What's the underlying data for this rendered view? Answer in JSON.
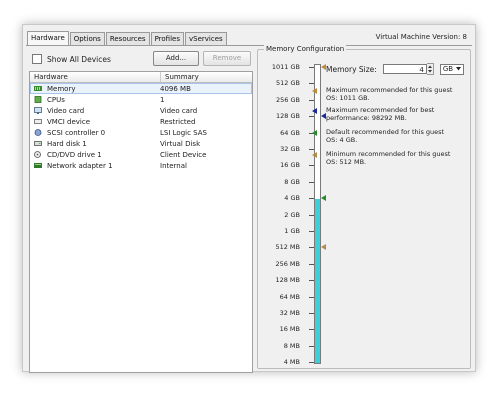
{
  "tabs": [
    {
      "label": "Hardware",
      "active": true
    },
    {
      "label": "Options",
      "active": false
    },
    {
      "label": "Resources",
      "active": false
    },
    {
      "label": "Profiles",
      "active": false
    },
    {
      "label": "vServices",
      "active": false
    }
  ],
  "vm_version": "Virtual Machine Version: 8",
  "show_all_label": "Show All Devices",
  "buttons": {
    "add": "Add...",
    "remove": "Remove"
  },
  "table": {
    "headers": [
      "Hardware",
      "Summary"
    ],
    "rows": [
      {
        "icon": "memory-icon",
        "name": "Memory",
        "summary": "4096 MB",
        "selected": true
      },
      {
        "icon": "cpu-icon",
        "name": "CPUs",
        "summary": "1",
        "selected": false
      },
      {
        "icon": "video-card-icon",
        "name": "Video card",
        "summary": "Video card",
        "selected": false
      },
      {
        "icon": "vmci-icon",
        "name": "VMCI device",
        "summary": "Restricted",
        "selected": false
      },
      {
        "icon": "scsi-icon",
        "name": "SCSI controller 0",
        "summary": "LSI Logic SAS",
        "selected": false
      },
      {
        "icon": "hard-disk-icon",
        "name": "Hard disk 1",
        "summary": "Virtual Disk",
        "selected": false
      },
      {
        "icon": "cd-dvd-icon",
        "name": "CD/DVD drive 1",
        "summary": "Client Device",
        "selected": false
      },
      {
        "icon": "network-adapter-icon",
        "name": "Network adapter 1",
        "summary": "Internal",
        "selected": false
      }
    ]
  },
  "memory_config": {
    "title": "Memory Configuration",
    "scale": [
      "1011 GB",
      "512 GB",
      "256 GB",
      "128 GB",
      "64 GB",
      "32 GB",
      "16 GB",
      "8 GB",
      "4 GB",
      "2 GB",
      "1 GB",
      "512 MB",
      "256 MB",
      "128 MB",
      "64 MB",
      "32 MB",
      "16 MB",
      "8 MB",
      "4 MB"
    ],
    "memory_size_label": "Memory Size:",
    "memory_size_value": "4",
    "unit": "GB",
    "current_level_label": "4 GB",
    "legend": [
      {
        "color": "#c08a3a",
        "text": "Maximum recommended for this guest OS: 1011 GB.",
        "at": "1011 GB"
      },
      {
        "color": "#1a2a9a",
        "text": "Maximum recommended for best performance: 98292 MB.",
        "at": "128 GB"
      },
      {
        "color": "#2a8a2a",
        "text": "Default recommended for this guest OS: 4 GB.",
        "at": "4 GB"
      },
      {
        "color": "#b48c4a",
        "text": "Minimum recommended for this guest OS: 512 MB.",
        "at": "512 MB"
      }
    ]
  }
}
